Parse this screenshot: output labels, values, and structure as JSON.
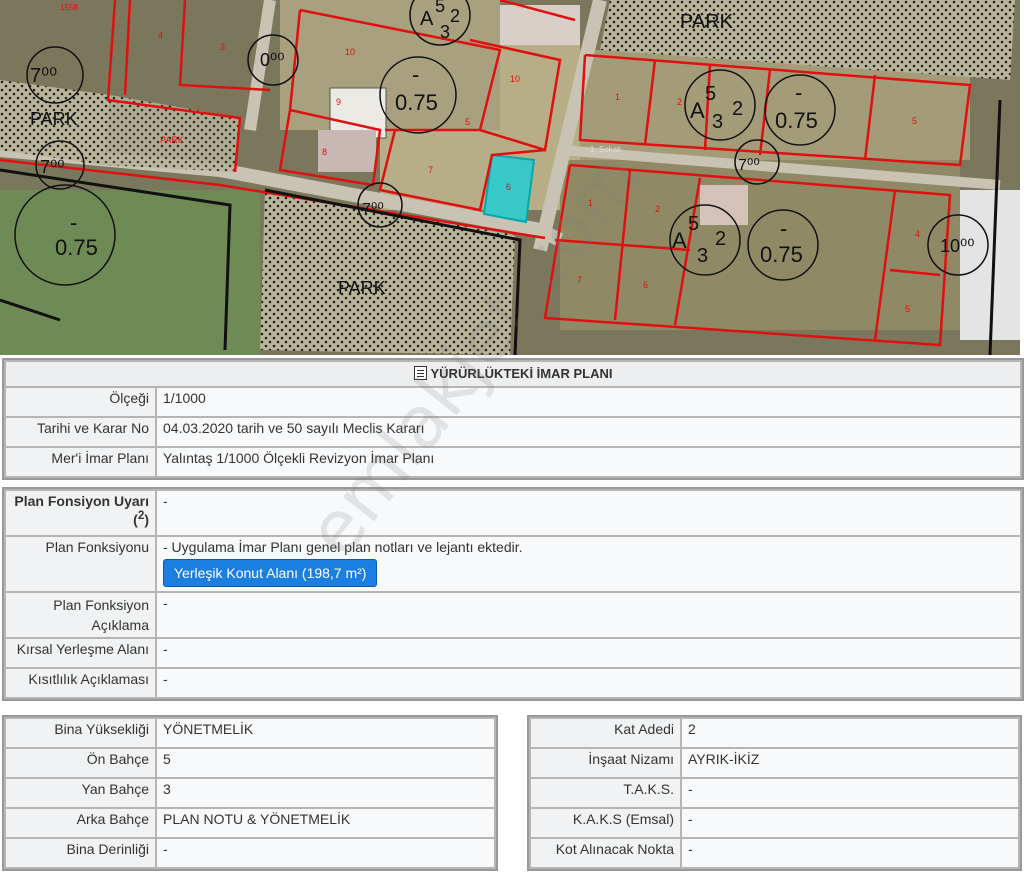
{
  "map": {
    "labels": {
      "park_top": "PARK",
      "park_left": "PARK",
      "park_small": "PARK",
      "park_bottom": "PARK",
      "street": "1. Sokak",
      "top_num": "1558"
    },
    "zone_codes": {
      "z1_a": "5",
      "z1_b": "2",
      "z1_c": "3",
      "z1_prefix": "A",
      "z2_a": "5",
      "z2_b": "2",
      "z2_c": "3",
      "z2_prefix": "A",
      "z3_a": "5",
      "z3_b": "2",
      "z3_c": "3",
      "z3_prefix": "A",
      "ratio": "0.75",
      "dash": "-"
    },
    "distances": {
      "d1": "7⁰⁰",
      "d2": "7⁰⁰",
      "d3": "7⁰⁰",
      "d4": "7⁰⁰",
      "d5": "10⁰⁰",
      "d6": "0⁰⁰"
    },
    "parcels": [
      "4",
      "3",
      "10",
      "9",
      "8",
      "5",
      "7",
      "6",
      "10",
      "1",
      "2",
      "5",
      "1",
      "2",
      "7",
      "6",
      "4",
      "5"
    ]
  },
  "plan": {
    "title": "YÜRÜRLÜKTEKİ İMAR PLANI",
    "rows": [
      {
        "label": "Ölçeği",
        "value": "1/1000"
      },
      {
        "label": "Tarihi ve Karar No",
        "value": "04.03.2020 tarih ve 50 sayılı Meclis Kararı"
      },
      {
        "label": "Mer'i İmar Planı",
        "value": "Yalıntaş 1/1000 Ölçekli Revizyon İmar Planı"
      }
    ]
  },
  "function": {
    "warning_label": "Plan Fonsiyon Uyarı",
    "warning_sup": "2",
    "warning_value": "-",
    "function_label": "Plan Fonksiyonu",
    "function_value": "- Uygulama İmar Planı genel plan notları ve lejantı ektedir.",
    "function_button": "Yerleşik Konut Alanı (198,7 m²)",
    "desc_label": "Plan Fonksiyon Açıklama",
    "desc_value": "-",
    "rural_label": "Kırsal Yerleşme Alanı",
    "rural_value": "-",
    "restriction_label": "Kısıtlılık Açıklaması",
    "restriction_value": "-"
  },
  "building_left": [
    {
      "label": "Bina Yüksekliği",
      "value": "YÖNETMELİK"
    },
    {
      "label": "Ön Bahçe",
      "value": "5"
    },
    {
      "label": "Yan Bahçe",
      "value": "3"
    },
    {
      "label": "Arka Bahçe",
      "value": "PLAN NOTU & YÖNETMELİK"
    },
    {
      "label": "Bina Derinliği",
      "value": "-"
    }
  ],
  "building_right": [
    {
      "label": "Kat Adedi",
      "value": "2"
    },
    {
      "label": "İnşaat Nizamı",
      "value": "AYRIK-İKİZ"
    },
    {
      "label": "T.A.K.S.",
      "value": "-"
    },
    {
      "label": "K.A.K.S (Emsal)",
      "value": "-"
    },
    {
      "label": "Kot Alınacak Nokta",
      "value": "-"
    }
  ],
  "watermark": "emlakjet.com"
}
